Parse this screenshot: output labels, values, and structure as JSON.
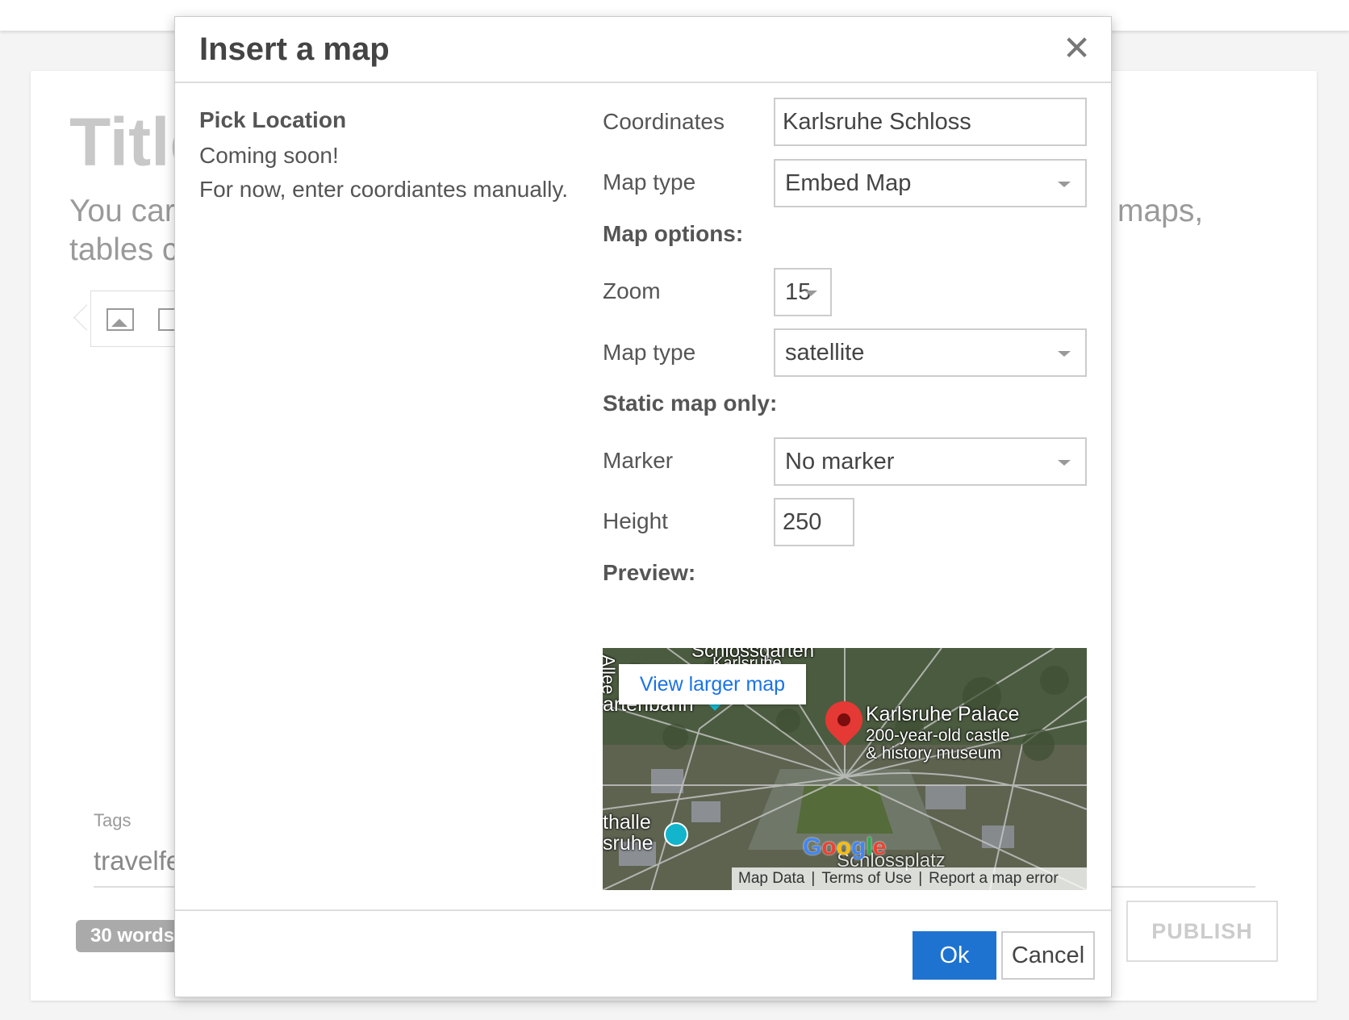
{
  "background": {
    "title": "Title",
    "intro_left": "You car",
    "intro_left_2": "tables c",
    "intro_right": "maps,",
    "tags_label": "Tags",
    "tags_value": "travelfe",
    "word_count": "30 words",
    "publish_label": "PUBLISH"
  },
  "dialog": {
    "title": "Insert a map",
    "close_icon": "close-icon",
    "pick_location": {
      "heading": "Pick Location",
      "status": "Coming soon!",
      "note": "For now, enter coordiantes manually."
    },
    "form": {
      "coordinates_label": "Coordinates",
      "coordinates_value": "Karlsruhe Schloss",
      "map_type_label": "Map type",
      "map_type_value": "Embed Map",
      "map_options_heading": "Map options:",
      "zoom_label": "Zoom",
      "zoom_value": "15",
      "map_type2_label": "Map type",
      "map_type2_value": "satellite",
      "static_heading": "Static map only:",
      "marker_label": "Marker",
      "marker_value": "No marker",
      "height_label": "Height",
      "height_value": "250",
      "preview_heading": "Preview:"
    },
    "preview": {
      "view_larger": "View larger map",
      "place_name": "Karlsruhe Palace",
      "place_desc_1": "200-year-old castle",
      "place_desc_2": "& history museum",
      "label_schlossgarten": "Schlossgarten",
      "label_karlsruhe_top": "Karlsruhe",
      "label_allee": "Allee",
      "label_gartenbahn": "artenbahn",
      "label_thalle": "thalle",
      "label_sruhe": "sruhe",
      "label_schlossplatz": "Schlossplatz",
      "google": "Google",
      "footer_map_data": "Map Data",
      "footer_terms": "Terms of Use",
      "footer_report": "Report a map error"
    },
    "buttons": {
      "ok": "Ok",
      "cancel": "Cancel"
    },
    "accent_color": "#1e73d0"
  }
}
